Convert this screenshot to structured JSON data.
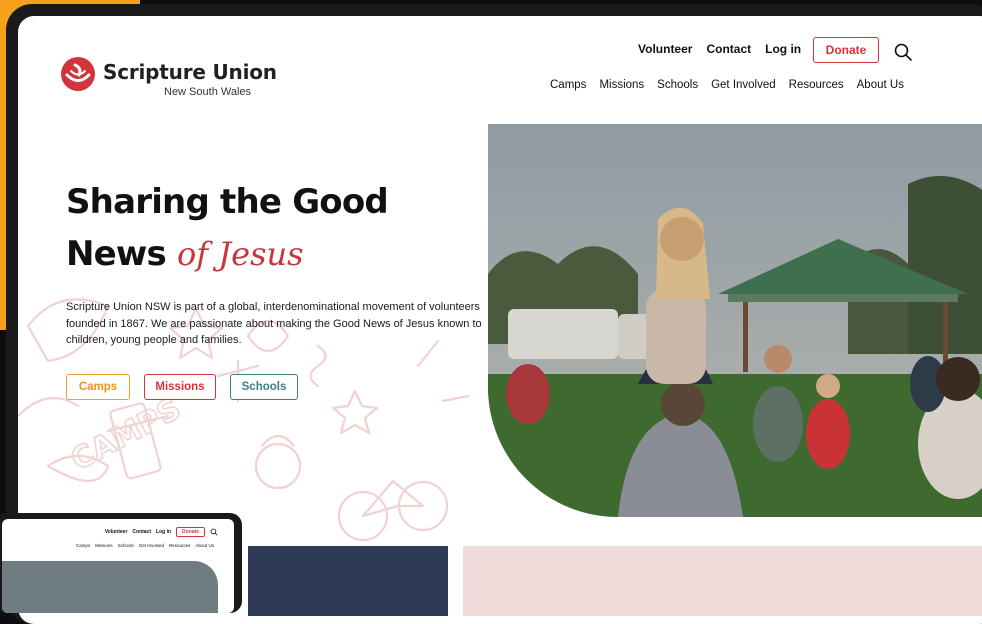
{
  "colors": {
    "brand_red": "#d2343c",
    "camps_orange": "#e8931e",
    "schools_teal": "#3b7f86",
    "backdrop_orange": "#f6a11a"
  },
  "brand": {
    "name": "Scripture Union",
    "region": "New South Wales",
    "logo_icon": "scripture-union-logo-icon"
  },
  "utility_nav": {
    "items": [
      "Volunteer",
      "Contact",
      "Log in"
    ],
    "donate_label": "Donate",
    "search_icon": "search-icon"
  },
  "main_nav": {
    "items": [
      "Camps",
      "Missions",
      "Schools",
      "Get Involved",
      "Resources",
      "About Us"
    ]
  },
  "hero": {
    "title_line1": "Sharing the Good",
    "title_line2": "News",
    "title_script": "of Jesus",
    "description": "Scripture Union NSW is part of a global, interdenominational movement of volunteers founded in 1867. We are passionate about making the Good News of Jesus known to children, young people and families.",
    "buttons": {
      "camps": "Camps",
      "missions": "Missions",
      "schools": "Schools"
    },
    "doodle_word": "CAMPS"
  },
  "mini_preview": {
    "utility_items": [
      "Volunteer",
      "Contact",
      "Log in"
    ],
    "donate_label": "Donate",
    "nav_items": [
      "Camps",
      "Missions",
      "Schools",
      "Get Involved",
      "Resources",
      "About Us"
    ]
  }
}
